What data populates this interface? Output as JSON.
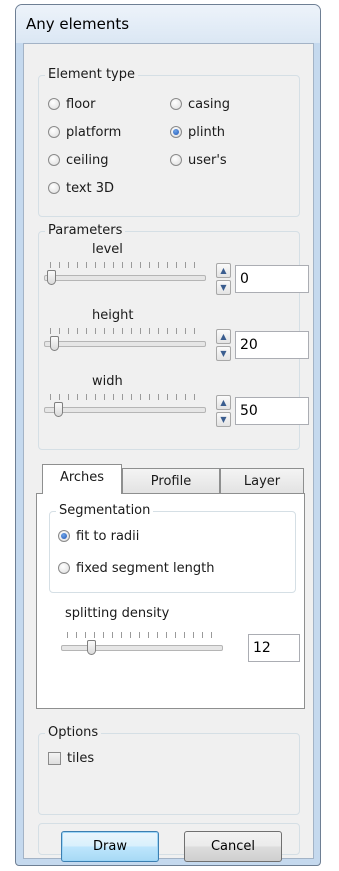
{
  "window": {
    "title": "Any elements"
  },
  "element_type": {
    "title": "Element type",
    "options": [
      {
        "label": "floor",
        "checked": false
      },
      {
        "label": "casing",
        "checked": false
      },
      {
        "label": "platform",
        "checked": false
      },
      {
        "label": "plinth",
        "checked": true
      },
      {
        "label": "ceiling",
        "checked": false
      },
      {
        "label": "user's",
        "checked": false
      },
      {
        "label": "text 3D",
        "checked": false
      }
    ]
  },
  "parameters": {
    "title": "Parameters",
    "level": {
      "label": "level",
      "value": "0"
    },
    "height": {
      "label": "height",
      "value": "20"
    },
    "width": {
      "label": "widh",
      "value": "50"
    }
  },
  "tabs": [
    {
      "label": "Arches",
      "active": true
    },
    {
      "label": "Profile",
      "active": false
    },
    {
      "label": "Layer",
      "active": false
    }
  ],
  "arches": {
    "segmentation": {
      "title": "Segmentation",
      "options": [
        {
          "label": "fit to radii",
          "checked": true
        },
        {
          "label": "fixed segment length",
          "checked": false
        }
      ]
    },
    "splitting_density": {
      "label": "splitting density",
      "value": "12"
    }
  },
  "options": {
    "title": "Options",
    "tiles": {
      "label": "tiles",
      "checked": false
    }
  },
  "buttons": {
    "draw": "Draw",
    "cancel": "Cancel"
  },
  "colors": {
    "window_frame": "#c5d9ee",
    "radio_selected": "#1f55b5",
    "default_button": "#bee6fd"
  },
  "icons": {
    "spin_up": "arrow-up-icon",
    "spin_down": "arrow-down-icon"
  }
}
